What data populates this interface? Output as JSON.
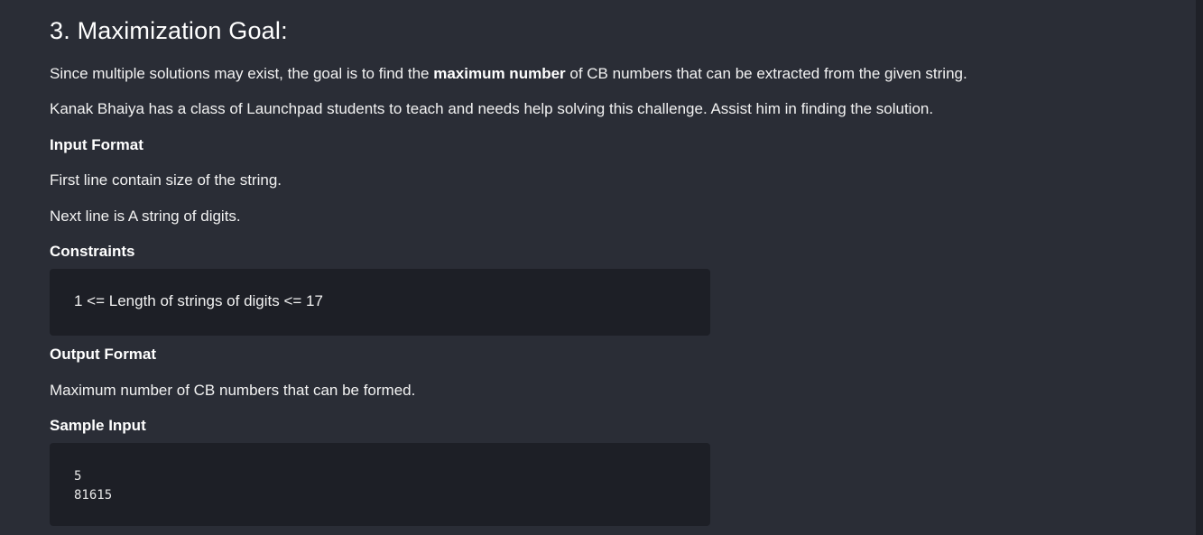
{
  "section": {
    "title": "3. Maximization Goal:",
    "goal_pre": "Since multiple solutions may exist, the goal is to find the ",
    "goal_bold": "maximum number",
    "goal_post": " of CB numbers that can be extracted from the given string.",
    "help_text": "Kanak Bhaiya has a class of Launchpad students to teach and needs help solving this challenge. Assist him in finding the solution."
  },
  "input_format": {
    "heading": "Input Format",
    "line1": "First line contain size of the string.",
    "line2": "Next line is A string of digits."
  },
  "constraints": {
    "heading": "Constraints",
    "text": "1 <= Length of strings of digits <= 17"
  },
  "output_format": {
    "heading": "Output Format",
    "text": "Maximum number of CB numbers that can be formed."
  },
  "sample_input": {
    "heading": "Sample Input",
    "code": "5\n81615"
  }
}
